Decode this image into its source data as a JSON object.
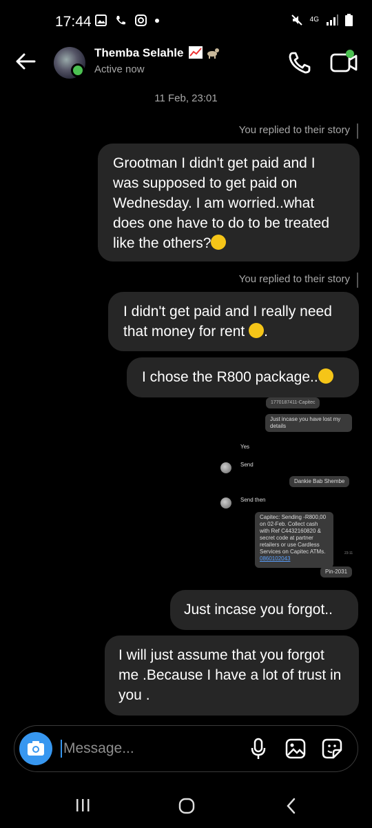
{
  "status_bar": {
    "time": "17:44",
    "network": "4G"
  },
  "header": {
    "name": "Themba Selahle",
    "status": "Active now"
  },
  "thread": {
    "date": "11 Feb, 23:01",
    "messages": [
      {
        "note": "You replied to their story",
        "text": "Grootman I didn't get paid and I was supposed to get paid on Wednesday. I am worried..what does one have to do to be treated like the others?"
      },
      {
        "note": "You replied to their story",
        "text": "I didn't get paid and I really need that money for rent"
      },
      {
        "text": "I chose the R800 package.."
      },
      {
        "text": "Just incase you forgot.."
      },
      {
        "text": "I will just assume that you forgot me .Because I have a lot of trust in you ."
      }
    ],
    "shared_image": {
      "top_text": "1770187411-Capitec",
      "lines": [
        "Just incase you have lost my details",
        "Yes",
        "Send",
        "Dankie Bab Shembe",
        "Send then",
        "Capitec: Sending -R800,00 on 02-Feb. Collect cash with Ref C4432160820 & secret code at partner retailers or use Cardless Services on Capitec ATMs.",
        "0860102043",
        "Pin-2031"
      ],
      "time": "23:11"
    }
  },
  "composer": {
    "placeholder": "Message..."
  },
  "colors": {
    "accent": "#3797f0",
    "online": "#4cc152",
    "bubble": "#262626"
  }
}
